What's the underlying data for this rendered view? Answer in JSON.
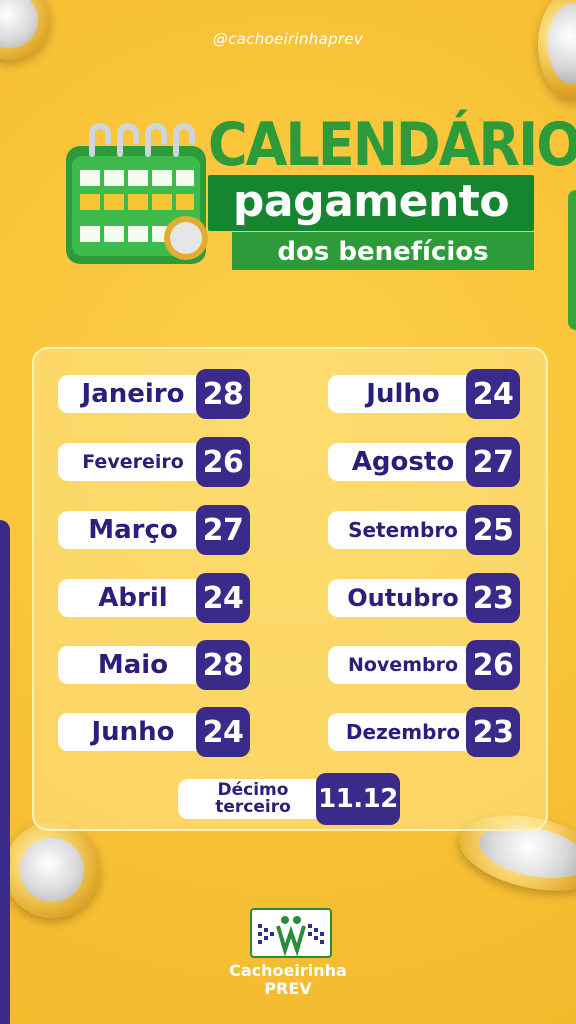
{
  "handle": "@cachoeirinhaprev",
  "title": {
    "line1": "CALENDÁRIO DE",
    "line2": "pagamento",
    "line3": "dos benefícios"
  },
  "months": [
    {
      "name": "Janeiro",
      "day": "28"
    },
    {
      "name": "Fevereiro",
      "day": "26"
    },
    {
      "name": "Março",
      "day": "27"
    },
    {
      "name": "Abril",
      "day": "24"
    },
    {
      "name": "Maio",
      "day": "28"
    },
    {
      "name": "Junho",
      "day": "24"
    },
    {
      "name": "Julho",
      "day": "24"
    },
    {
      "name": "Agosto",
      "day": "27"
    },
    {
      "name": "Setembro",
      "day": "25"
    },
    {
      "name": "Outubro",
      "day": "23"
    },
    {
      "name": "Novembro",
      "day": "26"
    },
    {
      "name": "Dezembro",
      "day": "23"
    }
  ],
  "thirteenth": {
    "line1": "Décimo",
    "line2": "terceiro",
    "date": "11.12"
  },
  "logo": {
    "name": "Cachoeirinha",
    "sub": "PREV"
  },
  "colors": {
    "background": "#f8c236",
    "accent_purple": "#3a2a8a",
    "accent_green": "#2d9b3a",
    "pill": "#ffffff"
  }
}
